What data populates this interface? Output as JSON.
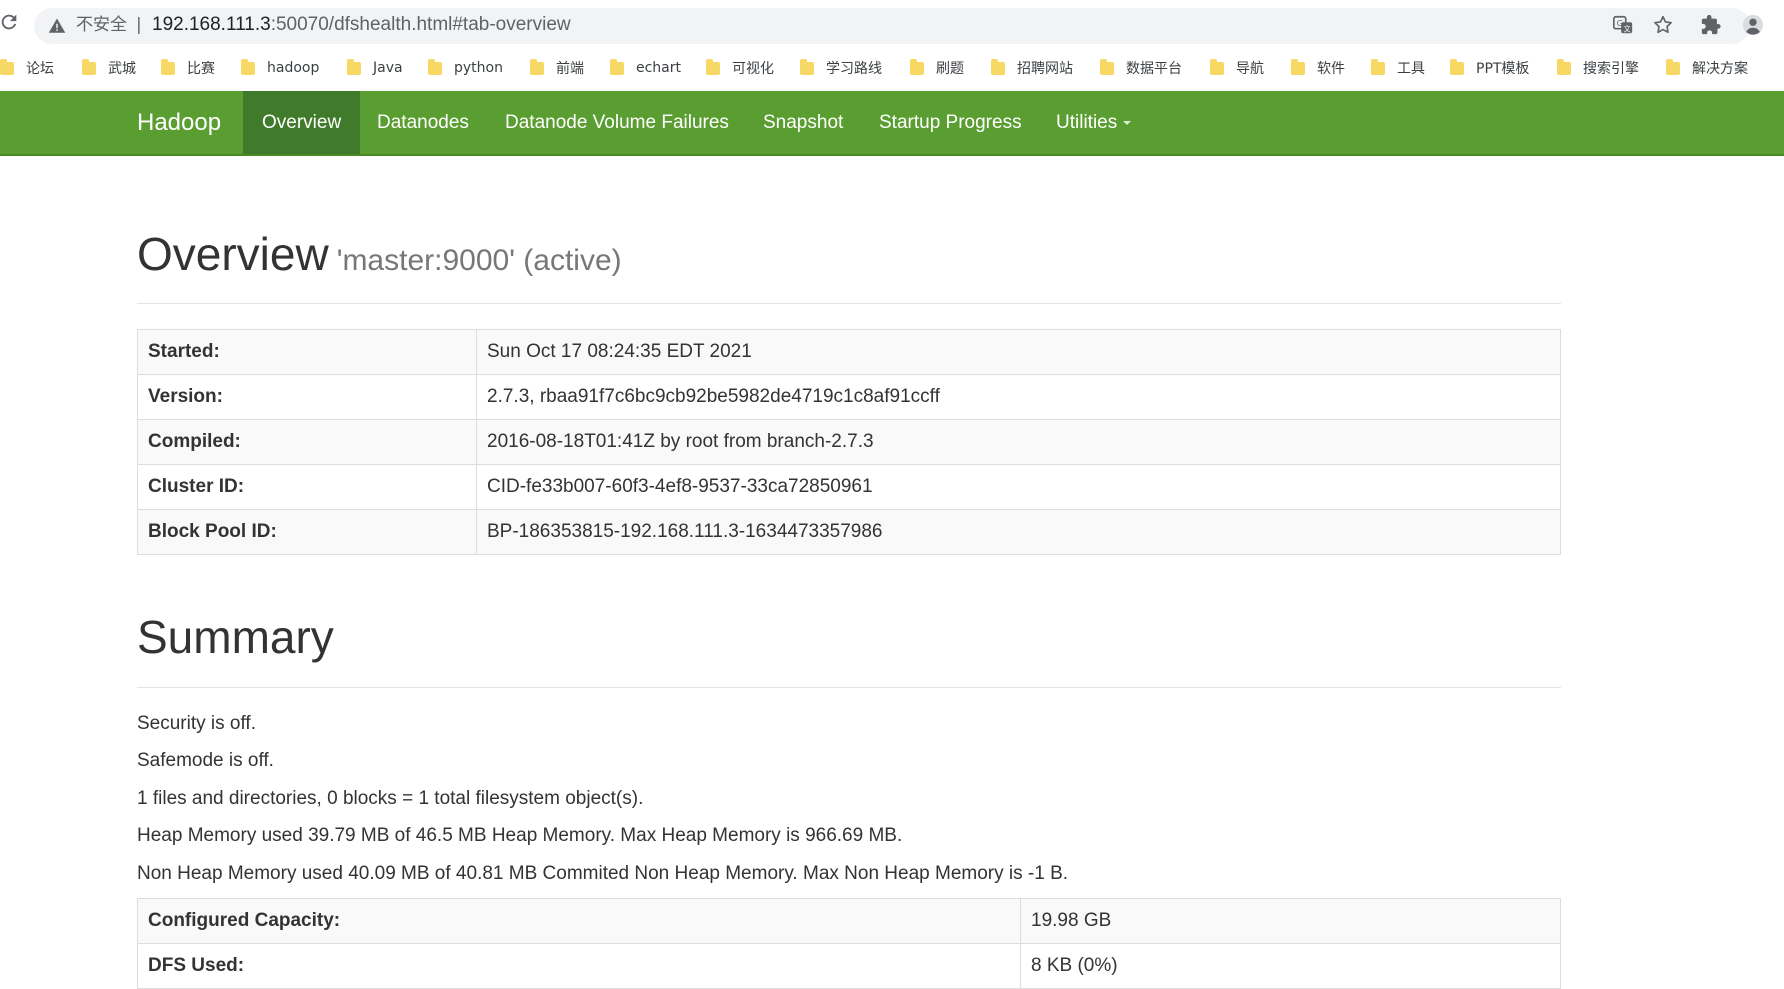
{
  "browser": {
    "insecure_label": "不安全",
    "url_host": "192.168.111.3",
    "url_rest": ":50070/dfshealth.html#tab-overview"
  },
  "bookmarks": [
    "论坛",
    "武城",
    "比赛",
    "hadoop",
    "Java",
    "python",
    "前端",
    "echart",
    "可视化",
    "学习路线",
    "刷题",
    "招聘网站",
    "数据平台",
    "导航",
    "软件",
    "工具",
    "PPT模板",
    "搜索引擎",
    "解决方案"
  ],
  "navbar": {
    "brand": "Hadoop",
    "items": [
      "Overview",
      "Datanodes",
      "Datanode Volume Failures",
      "Snapshot",
      "Startup Progress",
      "Utilities"
    ],
    "active": "Overview"
  },
  "overview": {
    "title": "Overview",
    "subtitle": "'master:9000' (active)",
    "rows": [
      {
        "k": "Started:",
        "v": "Sun Oct 17 08:24:35 EDT 2021"
      },
      {
        "k": "Version:",
        "v": "2.7.3, rbaa91f7c6bc9cb92be5982de4719c1c8af91ccff"
      },
      {
        "k": "Compiled:",
        "v": "2016-08-18T01:41Z by root from branch-2.7.3"
      },
      {
        "k": "Cluster ID:",
        "v": "CID-fe33b007-60f3-4ef8-9537-33ca72850961"
      },
      {
        "k": "Block Pool ID:",
        "v": "BP-186353815-192.168.111.3-1634473357986"
      }
    ]
  },
  "summary": {
    "title": "Summary",
    "lines": [
      "Security is off.",
      "Safemode is off.",
      "1 files and directories, 0 blocks = 1 total filesystem object(s).",
      "Heap Memory used 39.79 MB of 46.5 MB Heap Memory. Max Heap Memory is 966.69 MB.",
      "Non Heap Memory used 40.09 MB of 40.81 MB Commited Non Heap Memory. Max Non Heap Memory is -1 B."
    ],
    "rows": [
      {
        "k": "Configured Capacity:",
        "v": "19.98 GB"
      },
      {
        "k": "DFS Used:",
        "v": "8 KB (0%)"
      }
    ]
  },
  "colors": {
    "navbar": "#5a9e32",
    "navbar_active": "#3f7b2a"
  }
}
